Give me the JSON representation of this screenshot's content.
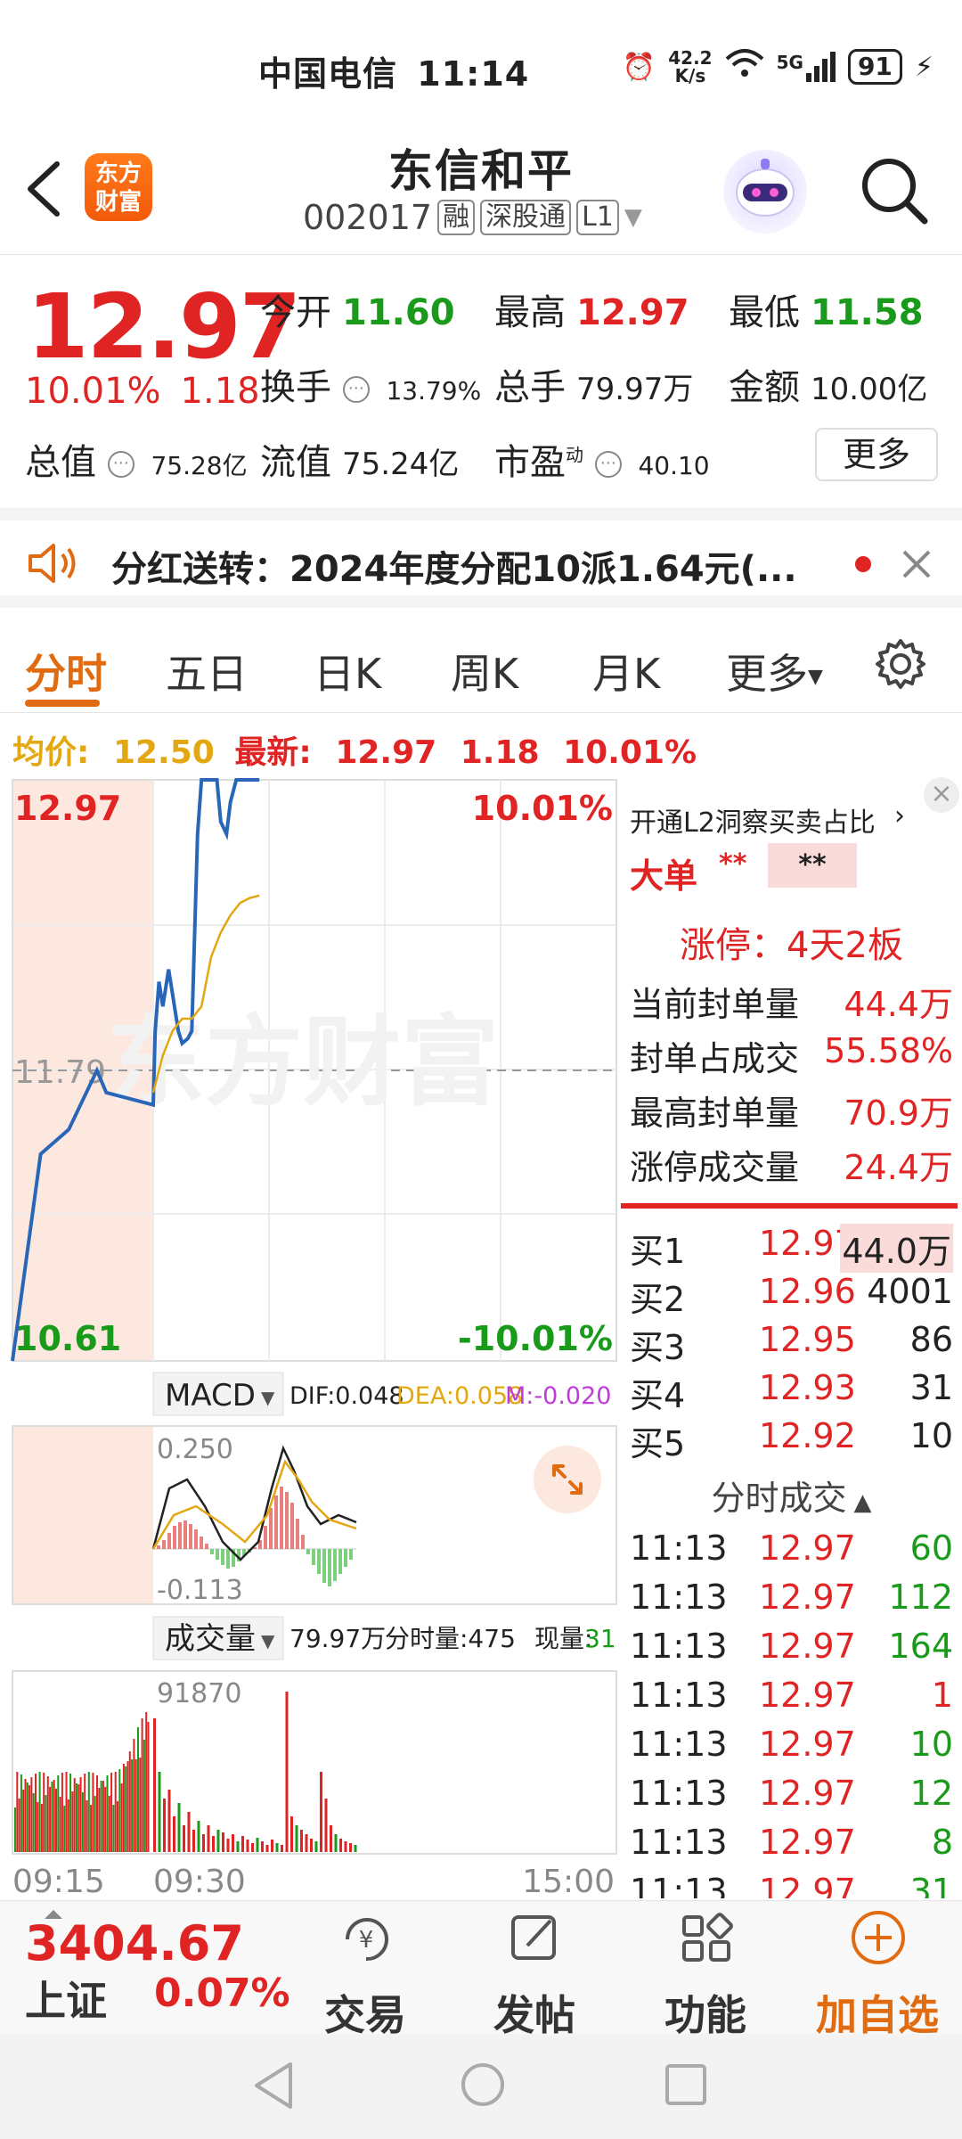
{
  "status": {
    "carrier": "中国电信",
    "time": "11:14",
    "speed_top": "42.2",
    "speed_bottom": "K/s",
    "net": "5G",
    "battery": "91"
  },
  "header": {
    "logo_top": "东方",
    "logo_bottom": "财富",
    "title": "东信和平",
    "code": "002017",
    "tags": [
      "融",
      "深股通",
      "L1"
    ]
  },
  "quote": {
    "price": "12.97",
    "change_pct": "10.01%",
    "change_val": "1.18",
    "open_label": "今开",
    "open": "11.60",
    "high_label": "最高",
    "high": "12.97",
    "low_label": "最低",
    "low": "11.58",
    "turnover_label": "换手",
    "turnover": "13.79%",
    "volume_label": "总手",
    "volume": "79.97万",
    "amount_label": "金额",
    "amount": "10.00亿",
    "mcap_label": "总值",
    "mcap": "75.28亿",
    "float_label": "流值",
    "float": "75.24亿",
    "pe_label": "市盈",
    "pe_sup": "动",
    "pe": "40.10",
    "more": "更多"
  },
  "notice": {
    "text": "分红送转：2024年度分配10派1.64元(..."
  },
  "tabs": {
    "items": [
      "分时",
      "五日",
      "日K",
      "周K",
      "月K",
      "更多"
    ]
  },
  "avg": {
    "avg_label": "均价:",
    "avg": "12.50",
    "latest_label": "最新:",
    "latest": "12.97",
    "chg": "1.18",
    "pct": "10.01%"
  },
  "chart_data": {
    "type": "line",
    "price_top": "12.97",
    "price_mid": "11.79",
    "price_bottom": "10.61",
    "pct_top": "10.01%",
    "pct_bottom": "-10.01%",
    "watermark": "东方财富",
    "y_range": [
      10.61,
      12.97
    ],
    "x_labels": [
      "09:15",
      "09:30",
      "15:00"
    ],
    "series": [
      {
        "x": [
          "09:15",
          "09:18",
          "09:21",
          "09:24",
          "09:25",
          "09:30",
          "09:31",
          "09:33",
          "09:35",
          "09:38",
          "09:40",
          "09:43",
          "09:45",
          "09:48",
          "09:50",
          "09:53",
          "09:55",
          "09:58",
          "10:00",
          "10:03",
          "10:05",
          "10:08",
          "10:10",
          "10:13",
          "10:15",
          "10:16",
          "10:18",
          "10:20",
          "10:22",
          "10:25"
        ],
        "values": [
          10.61,
          11.45,
          11.55,
          11.79,
          11.7,
          11.65,
          11.95,
          12.15,
          12.05,
          12.2,
          12.1,
          11.95,
          11.9,
          11.92,
          11.95,
          12.75,
          12.97,
          12.97,
          12.97,
          12.97,
          12.8,
          12.75,
          12.88,
          12.97,
          12.97,
          12.97,
          12.97,
          12.97,
          12.97,
          12.97
        ]
      },
      {
        "x": [
          "09:30",
          "09:35",
          "09:40",
          "09:45",
          "09:50",
          "09:55",
          "10:00",
          "10:05",
          "10:10",
          "10:15",
          "10:20",
          "10:25"
        ],
        "values": [
          11.7,
          11.85,
          11.95,
          12.0,
          12.0,
          12.05,
          12.25,
          12.35,
          12.42,
          12.47,
          12.49,
          12.5
        ]
      }
    ],
    "macd": {
      "label": "MACD",
      "dif": "DIF:0.048",
      "dea": "DEA:0.058",
      "m": "M:-0.020",
      "top": "0.250",
      "bottom": "-0.113"
    },
    "vol": {
      "label": "成交量",
      "total": "79.97万",
      "tick": "分时量:475",
      "now_label": "现量:",
      "now": "31",
      "top": "91870"
    }
  },
  "panel": {
    "l2": "开通L2洞察买卖占比",
    "big_label": "大单",
    "big1": "**",
    "big2": "**",
    "limit": "涨停：4天2板",
    "stats": [
      {
        "label": "当前封单量",
        "value": "44.4万"
      },
      {
        "label": "封单占成交",
        "value": "55.58%"
      },
      {
        "label": "最高封单量",
        "value": "70.9万"
      },
      {
        "label": "涨停成交量",
        "value": "24.4万"
      }
    ],
    "bids": [
      {
        "label": "买1",
        "price": "12.97",
        "qty": "44.0万"
      },
      {
        "label": "买2",
        "price": "12.96",
        "qty": "4001"
      },
      {
        "label": "买3",
        "price": "12.95",
        "qty": "86"
      },
      {
        "label": "买4",
        "price": "12.93",
        "qty": "31"
      },
      {
        "label": "买5",
        "price": "12.92",
        "qty": "10"
      }
    ],
    "ticks_title": "分时成交",
    "ticks": [
      {
        "t": "11:13",
        "p": "12.97",
        "q": "60"
      },
      {
        "t": "11:13",
        "p": "12.97",
        "q": "112"
      },
      {
        "t": "11:13",
        "p": "12.97",
        "q": "164"
      },
      {
        "t": "11:13",
        "p": "12.97",
        "q": "1"
      },
      {
        "t": "11:13",
        "p": "12.97",
        "q": "10"
      },
      {
        "t": "11:13",
        "p": "12.97",
        "q": "12"
      },
      {
        "t": "11:13",
        "p": "12.97",
        "q": "8"
      },
      {
        "t": "11:13",
        "p": "12.97",
        "q": "31"
      }
    ]
  },
  "bottom": {
    "index_value": "3404.67",
    "index_name": "上证",
    "index_pct": "0.07%",
    "items": [
      "交易",
      "发帖",
      "功能",
      "加自选"
    ]
  }
}
